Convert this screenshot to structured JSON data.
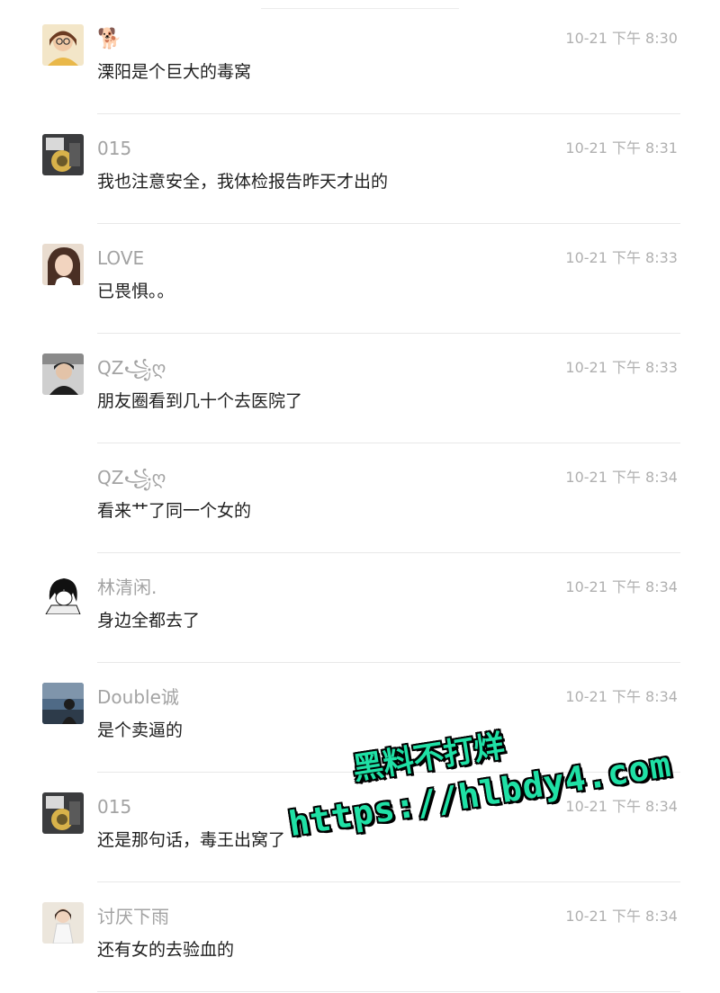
{
  "comments": [
    {
      "name": "",
      "name_icon": "🐕",
      "time": "10-21 下午 8:30",
      "text": "溧阳是个巨大的毒窝",
      "avatar": "avatar-1"
    },
    {
      "name": "015",
      "time": "10-21 下午 8:31",
      "text": "我也注意安全，我体检报告昨天才出的",
      "avatar": "avatar-2"
    },
    {
      "name": "LOVE",
      "time": "10-21 下午 8:33",
      "text": "已畏惧。。",
      "avatar": "avatar-3"
    },
    {
      "name": "QZ꧁ღ",
      "time": "10-21 下午 8:33",
      "text": "朋友圈看到几十个去医院了",
      "avatar": "avatar-4"
    },
    {
      "name": "QZ꧁ღ",
      "time": "10-21 下午 8:34",
      "text": "看来艹了同一个女的",
      "avatar": "none"
    },
    {
      "name": "林清闲.",
      "time": "10-21 下午 8:34",
      "text": "身边全都去了",
      "avatar": "avatar-5"
    },
    {
      "name": "Double诚",
      "time": "10-21 下午 8:34",
      "text": "是个卖逼的",
      "avatar": "avatar-6"
    },
    {
      "name": "015",
      "time": "10-21 下午 8:34",
      "text": "还是那句话，毒王出窝了",
      "avatar": "avatar-2"
    },
    {
      "name": "讨厌下雨",
      "time": "10-21 下午 8:34",
      "text": "还有女的去验血的",
      "avatar": "avatar-7"
    }
  ],
  "watermark": {
    "line1": "黑料不打烊",
    "line2": "https://hlbdy4.com"
  },
  "colors": {
    "name": "#a3a3a3",
    "time": "#b0b0b0",
    "text": "#1f1f1f",
    "divider": "#e8e8e8",
    "watermark": "#1fe0a5"
  }
}
